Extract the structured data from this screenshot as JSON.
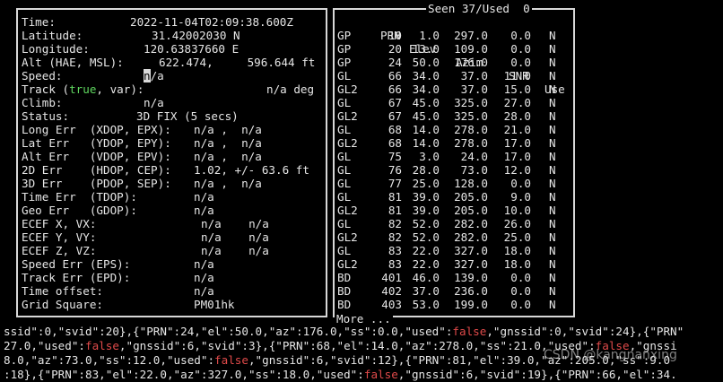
{
  "left": {
    "time": {
      "label": "Time:",
      "value": "2022-11-04T02:09:38.600Z"
    },
    "latitude": {
      "label": "Latitude:",
      "value": "31.42002030 N"
    },
    "longitude": {
      "label": "Longitude:",
      "value": "120.63837660 E"
    },
    "alt": {
      "label": "Alt (HAE, MSL):",
      "value": "622.474,     596.644 ft"
    },
    "speed": {
      "label": "Speed:",
      "cursor_char": "n",
      "value_rest": "/a"
    },
    "track": {
      "label_a": "Track (",
      "label_true": "true",
      "label_b": ", var):",
      "value": "n/a deg"
    },
    "climb": {
      "label": "Climb:",
      "value": "n/a"
    },
    "status": {
      "label": "Status:",
      "value": "3D FIX (5 secs)"
    },
    "long_err": {
      "label": "Long Err  (XDOP, EPX):",
      "value": "n/a ,  n/a"
    },
    "lat_err": {
      "label": "Lat Err   (YDOP, EPY):",
      "value": "n/a ,  n/a"
    },
    "alt_err": {
      "label": "Alt Err   (VDOP, EPV):",
      "value": "n/a ,  n/a"
    },
    "err_2d": {
      "label": "2D Err    (HDOP, CEP):",
      "value": "1.02, +/- 63.6 ft"
    },
    "err_3d": {
      "label": "3D Err    (PDOP, SEP):",
      "value": "n/a ,  n/a"
    },
    "time_err": {
      "label": "Time Err  (TDOP):",
      "value": "n/a"
    },
    "geo_err": {
      "label": "Geo Err   (GDOP):",
      "value": "n/a"
    },
    "ecef_x": {
      "label": "ECEF X, VX:",
      "value": "n/a    n/a"
    },
    "ecef_y": {
      "label": "ECEF Y, VY:",
      "value": "n/a    n/a"
    },
    "ecef_z": {
      "label": "ECEF Z, VZ:",
      "value": "n/a    n/a"
    },
    "speed_err": {
      "label": "Speed Err (EPS):",
      "value": "n/a"
    },
    "track_err": {
      "label": "Track Err (EPD):",
      "value": "n/a"
    },
    "time_offset": {
      "label": "Time offset:",
      "value": "n/a"
    },
    "grid_square": {
      "label": "Grid Square:",
      "value": "PM01hk"
    }
  },
  "right": {
    "seen_label": "Seen 37/Used  0",
    "more_label": "More ...",
    "headers": {
      "prn": "PRN",
      "elev": "Elev",
      "azim": "Azim",
      "snr": "SNR",
      "use": "Use"
    },
    "rows": [
      {
        "gnss": "GP",
        "prn": "10",
        "elev": "1.0",
        "azim": "297.0",
        "snr": "0.0",
        "use": "N"
      },
      {
        "gnss": "GP",
        "prn": "20",
        "elev": "13.0",
        "azim": "109.0",
        "snr": "0.0",
        "use": "N"
      },
      {
        "gnss": "GP",
        "prn": "24",
        "elev": "50.0",
        "azim": "176.0",
        "snr": "0.0",
        "use": "N"
      },
      {
        "gnss": "GL",
        "prn": "66",
        "elev": "34.0",
        "azim": "37.0",
        "snr": "11.0",
        "use": "N"
      },
      {
        "gnss": "GL2",
        "prn": "66",
        "elev": "34.0",
        "azim": "37.0",
        "snr": "15.0",
        "use": "N"
      },
      {
        "gnss": "GL",
        "prn": "67",
        "elev": "45.0",
        "azim": "325.0",
        "snr": "27.0",
        "use": "N"
      },
      {
        "gnss": "GL2",
        "prn": "67",
        "elev": "45.0",
        "azim": "325.0",
        "snr": "28.0",
        "use": "N"
      },
      {
        "gnss": "GL",
        "prn": "68",
        "elev": "14.0",
        "azim": "278.0",
        "snr": "21.0",
        "use": "N"
      },
      {
        "gnss": "GL2",
        "prn": "68",
        "elev": "14.0",
        "azim": "278.0",
        "snr": "17.0",
        "use": "N"
      },
      {
        "gnss": "GL",
        "prn": "75",
        "elev": "3.0",
        "azim": "24.0",
        "snr": "17.0",
        "use": "N"
      },
      {
        "gnss": "GL",
        "prn": "76",
        "elev": "28.0",
        "azim": "73.0",
        "snr": "12.0",
        "use": "N"
      },
      {
        "gnss": "GL",
        "prn": "77",
        "elev": "25.0",
        "azim": "128.0",
        "snr": "0.0",
        "use": "N"
      },
      {
        "gnss": "GL",
        "prn": "81",
        "elev": "39.0",
        "azim": "205.0",
        "snr": "9.0",
        "use": "N"
      },
      {
        "gnss": "GL2",
        "prn": "81",
        "elev": "39.0",
        "azim": "205.0",
        "snr": "10.0",
        "use": "N"
      },
      {
        "gnss": "GL",
        "prn": "82",
        "elev": "52.0",
        "azim": "282.0",
        "snr": "26.0",
        "use": "N"
      },
      {
        "gnss": "GL2",
        "prn": "82",
        "elev": "52.0",
        "azim": "282.0",
        "snr": "25.0",
        "use": "N"
      },
      {
        "gnss": "GL",
        "prn": "83",
        "elev": "22.0",
        "azim": "327.0",
        "snr": "18.0",
        "use": "N"
      },
      {
        "gnss": "GL2",
        "prn": "83",
        "elev": "22.0",
        "azim": "327.0",
        "snr": "18.0",
        "use": "N"
      },
      {
        "gnss": "BD",
        "prn": "401",
        "elev": "46.0",
        "azim": "139.0",
        "snr": "0.0",
        "use": "N"
      },
      {
        "gnss": "BD",
        "prn": "402",
        "elev": "37.0",
        "azim": "236.0",
        "snr": "0.0",
        "use": "N"
      },
      {
        "gnss": "BD",
        "prn": "403",
        "elev": "53.0",
        "azim": "199.0",
        "snr": "0.0",
        "use": "N"
      }
    ]
  },
  "json_output": {
    "line1": [
      {
        "t": "ssid\":0,\"svid\":20},{\"PRN\":24,\"el\":50.0,\"az\":176.0,\"ss\":0.0,\"used\":",
        "c": "n"
      },
      {
        "t": "false",
        "c": "f"
      },
      {
        "t": ",\"gnssid\":0,\"svid\":24},{\"PRN\"",
        "c": "n"
      }
    ],
    "line2": [
      {
        "t": "27.0,\"used\":",
        "c": "n"
      },
      {
        "t": "false",
        "c": "f"
      },
      {
        "t": ",\"gnssid\":6,\"svid\":3},{\"PRN\":68,\"el\":14.0,\"az\":278.0,\"ss\":21.0,\"used\":",
        "c": "n"
      },
      {
        "t": "false",
        "c": "f"
      },
      {
        "t": ",\"gnssi",
        "c": "n"
      }
    ],
    "line3": [
      {
        "t": "8.0,\"az\":73.0,\"ss\":12.0,\"used\":",
        "c": "n"
      },
      {
        "t": "false",
        "c": "f"
      },
      {
        "t": ",\"gnssid\":6,\"svid\":12},{\"PRN\":81,\"el\":39.0,\"az\":205.0,\"ss\":9.0",
        "c": "n"
      }
    ],
    "line4": [
      {
        "t": ":18},{\"PRN\":83,\"el\":22.0,\"az\":327.0,\"ss\":18.0,\"used\":",
        "c": "n"
      },
      {
        "t": "false",
        "c": "f"
      },
      {
        "t": ",\"gnssid\":6,\"svid\":19},{\"PRN\":66,\"el\":34.",
        "c": "n"
      }
    ]
  },
  "watermark": "CSDN @kangnanxing",
  "colors": {
    "background": "#000000",
    "text": "#e6e6e6",
    "true_green": "#5fd75f",
    "false_red": "#e04a4a"
  }
}
